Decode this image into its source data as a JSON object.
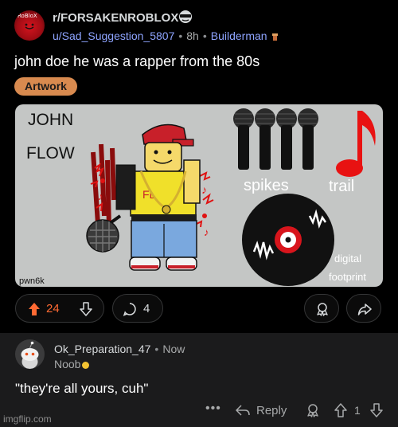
{
  "post": {
    "subreddit": "r/FORSAKENROBLOX",
    "subreddit_avatar_text": "RoBloX",
    "author": "u/Sad_Suggestion_5807",
    "age": "8h",
    "user_flair": "Builderman",
    "title": "john doe he was a rapper from the 80s",
    "tag": "Artwork",
    "tag_color": "#d88a4f",
    "image": {
      "text_john": "JOHN",
      "text_flow": "FLOW",
      "text_spikes": "spikes",
      "text_trail": "trail",
      "text_digital": "digital",
      "text_footprint": "footprint",
      "text_signature": "pwn6k"
    },
    "upvotes": "24",
    "comments": "4",
    "upvote_color": "#ff6a33"
  },
  "comment": {
    "author": "Ok_Preparation_47",
    "age": "Now",
    "flair": "Noob",
    "body": "\"they're all yours, cuh\"",
    "more_label": "•••",
    "reply_label": "Reply",
    "score": "1"
  },
  "watermark": "imgflip.com",
  "icons": {
    "upvote": "arrow-up-icon",
    "downvote": "arrow-down-icon",
    "comment": "speech-bubble-icon",
    "award": "award-icon",
    "share": "share-icon",
    "reply": "reply-arrow-icon"
  }
}
